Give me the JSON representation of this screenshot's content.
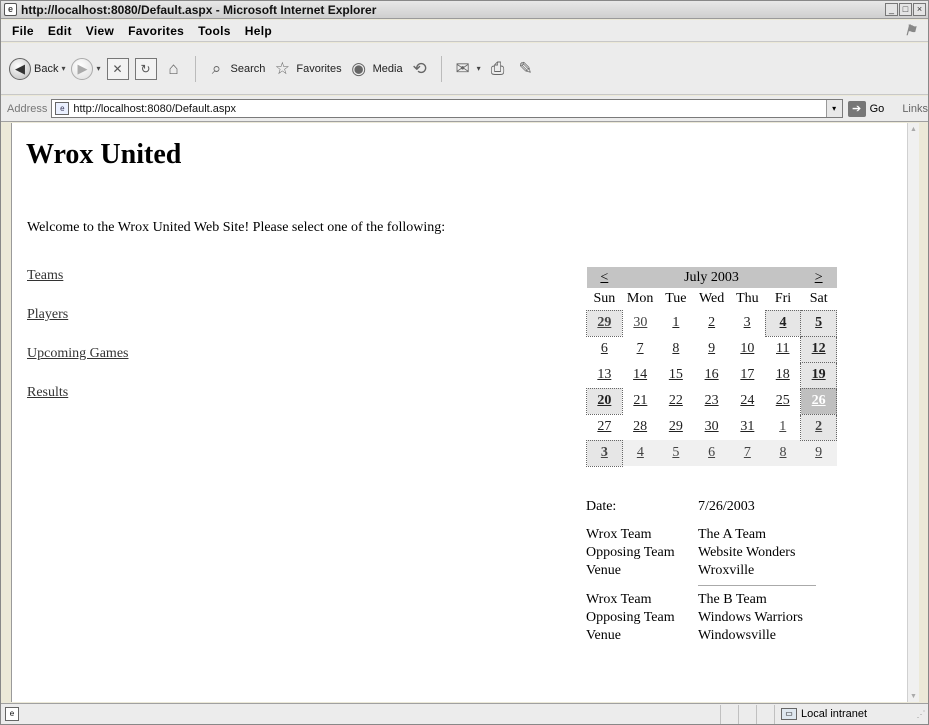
{
  "window": {
    "title": "http://localhost:8080/Default.aspx - Microsoft Internet Explorer",
    "app_icon": "e",
    "buttons": {
      "minimize": "_",
      "maximize": "□",
      "close": "×"
    }
  },
  "menu": {
    "items": [
      "File",
      "Edit",
      "View",
      "Favorites",
      "Tools",
      "Help"
    ]
  },
  "toolbar": {
    "back_label": "Back",
    "search_label": "Search",
    "favorites_label": "Favorites",
    "media_label": "Media",
    "icons": {
      "back": "◀",
      "forward": "▶",
      "stop": "✕",
      "refresh": "↻",
      "home": "⌂",
      "search": "⌕",
      "favorites": "☆",
      "media": "◉",
      "history": "⟲",
      "mail": "✉",
      "print": "⎙",
      "edit": "✎",
      "dropdown": "▾"
    }
  },
  "address": {
    "label": "Address",
    "url": "http://localhost:8080/Default.aspx",
    "go_label": "Go",
    "links_label": "Links",
    "page_icon": "e",
    "dropdown_icon": "▾",
    "go_icon": "➔"
  },
  "page": {
    "title": "Wrox United",
    "welcome": "Welcome to the Wrox United Web Site! Please select one of the following:",
    "links": [
      "Teams",
      "Players",
      "Upcoming Games",
      "Results"
    ]
  },
  "calendar": {
    "prev": "<",
    "next": ">",
    "month_label": "July 2003",
    "day_headers": [
      "Sun",
      "Mon",
      "Tue",
      "Wed",
      "Thu",
      "Fri",
      "Sat"
    ],
    "weeks": [
      [
        "29",
        "30",
        "1",
        "2",
        "3",
        "4",
        "5"
      ],
      [
        "6",
        "7",
        "8",
        "9",
        "10",
        "11",
        "12"
      ],
      [
        "13",
        "14",
        "15",
        "16",
        "17",
        "18",
        "19"
      ],
      [
        "20",
        "21",
        "22",
        "23",
        "24",
        "25",
        "26"
      ],
      [
        "27",
        "28",
        "29",
        "30",
        "31",
        "1",
        "2"
      ],
      [
        "3",
        "4",
        "5",
        "6",
        "7",
        "8",
        "9"
      ]
    ],
    "selected_date": "26",
    "match_days": [
      "29",
      "4",
      "5",
      "12",
      "19",
      "20",
      "26",
      "2",
      "3"
    ]
  },
  "details": {
    "date_label": "Date:",
    "date_value": "7/26/2003",
    "matches": [
      {
        "wrox_team_label": "Wrox Team",
        "wrox_team": "The A Team",
        "opposing_label": "Opposing Team",
        "opposing": "Website Wonders",
        "venue_label": "Venue",
        "venue": "Wroxville"
      },
      {
        "wrox_team_label": "Wrox Team",
        "wrox_team": "The B Team",
        "opposing_label": "Opposing Team",
        "opposing": "Windows Warriors",
        "venue_label": "Venue",
        "venue": "Windowsville"
      }
    ]
  },
  "status": {
    "page_icon": "e",
    "text": "",
    "zone_label": "Local intranet",
    "zone_icon": "▭",
    "grip": "⋰"
  }
}
